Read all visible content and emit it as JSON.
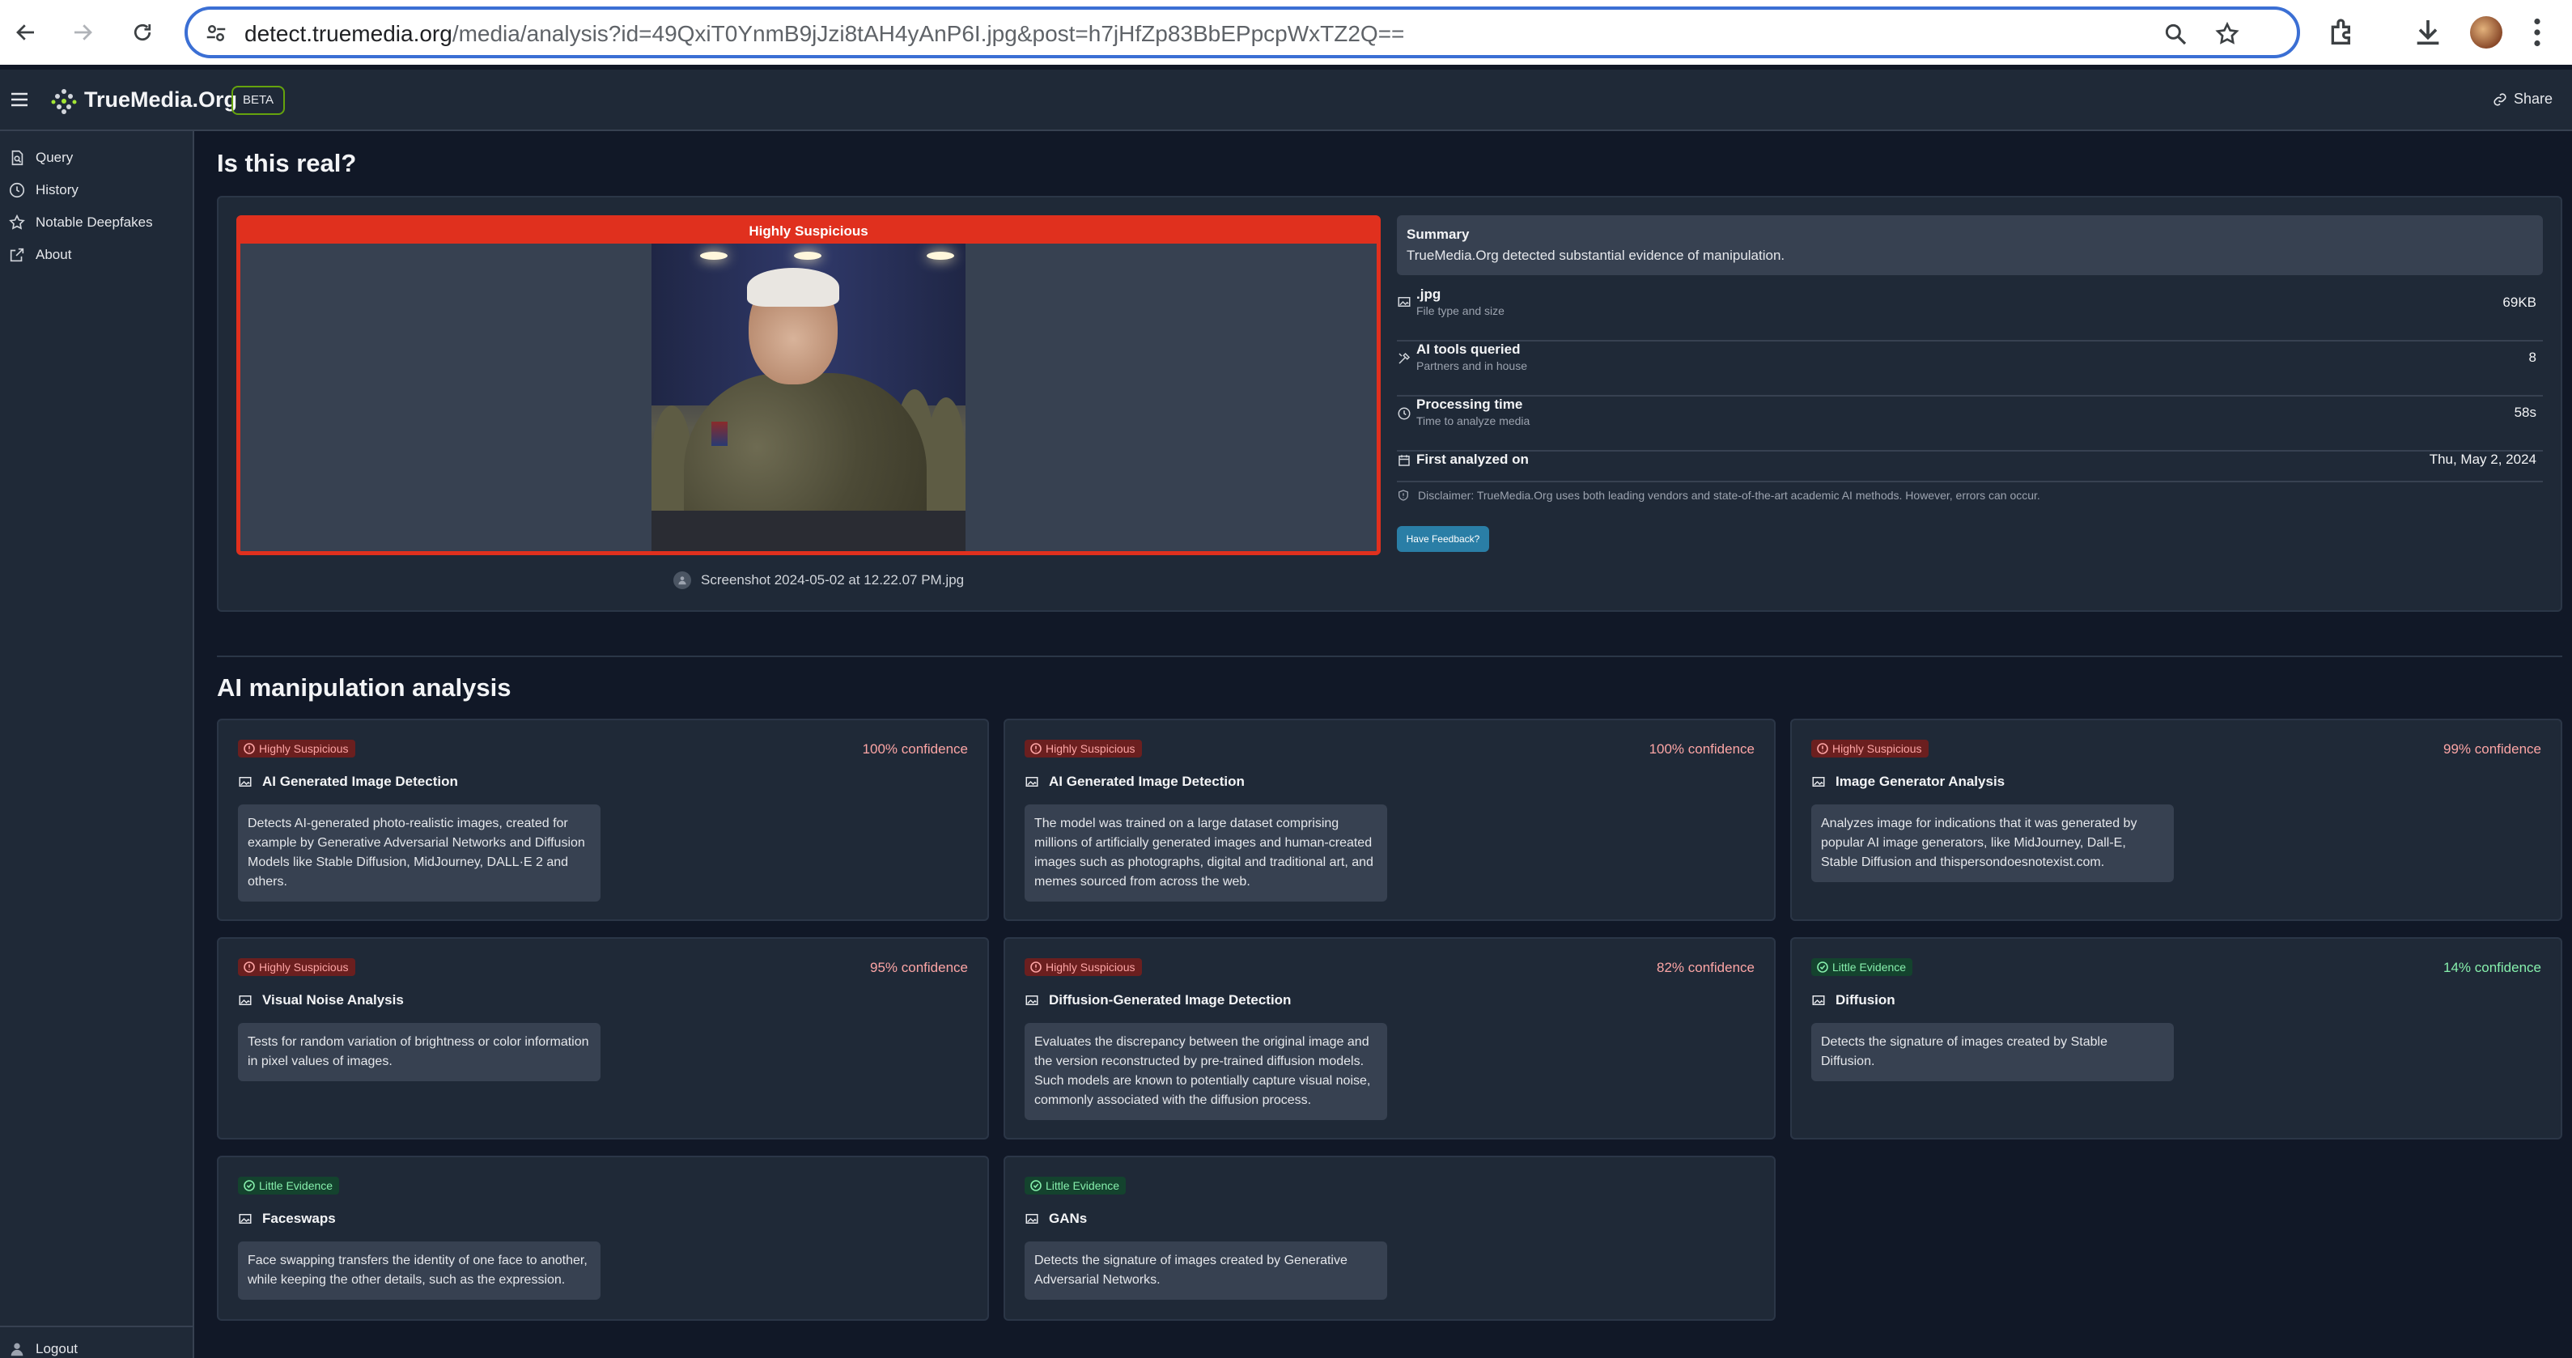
{
  "browser": {
    "url_host": "detect.truemedia.org",
    "url_path": "/media/analysis?id=49QxiT0YnmB9jJzi8tAH4yAnP6I.jpg&post=h7jHfZp83BbEPpcpWxTZ2Q=="
  },
  "app": {
    "brand": "TrueMedia.Org",
    "beta": "BETA",
    "share": "Share"
  },
  "sidebar": {
    "items": [
      {
        "label": "Query",
        "icon": "query-icon"
      },
      {
        "label": "History",
        "icon": "history-icon"
      },
      {
        "label": "Notable Deepfakes",
        "icon": "star-icon"
      },
      {
        "label": "About",
        "icon": "external-link-icon"
      }
    ],
    "logout": "Logout"
  },
  "page": {
    "title": "Is this real?",
    "verdict": "Highly Suspicious",
    "filename": "Screenshot 2024-05-02 at 12.22.07 PM.jpg",
    "summary_title": "Summary",
    "summary_text": "TrueMedia.Org detected substantial evidence of manipulation.",
    "info": [
      {
        "label": ".jpg",
        "sub": "File type and size",
        "value": "69KB"
      },
      {
        "label": "AI tools queried",
        "sub": "Partners and in house",
        "value": "8"
      },
      {
        "label": "Processing time",
        "sub": "Time to analyze media",
        "value": "58s"
      },
      {
        "label": "First analyzed on",
        "sub": "",
        "value": "Thu, May 2, 2024"
      }
    ],
    "disclaimer": "Disclaimer: TrueMedia.Org uses both leading vendors and state-of-the-art academic AI methods. However, errors can occur.",
    "feedback": "Have Feedback?",
    "analysis_title": "AI manipulation analysis"
  },
  "colors": {
    "suspicious": "#e0301e",
    "little_evidence": "#86efac",
    "feedback_button": "#2a7ea6",
    "beta_border": "#65a30d"
  },
  "cards": [
    {
      "status": "Highly Suspicious",
      "confidence": "100% confidence",
      "title": "AI Generated Image Detection",
      "desc": "Detects AI-generated photo-realistic images, created for example by Generative Adversarial Networks and Diffusion Models like Stable Diffusion, MidJourney, DALL·E 2 and others."
    },
    {
      "status": "Highly Suspicious",
      "confidence": "100% confidence",
      "title": "AI Generated Image Detection",
      "desc": "The model was trained on a large dataset comprising millions of artificially generated images and human-created images such as photographs, digital and traditional art, and memes sourced from across the web."
    },
    {
      "status": "Highly Suspicious",
      "confidence": "99% confidence",
      "title": "Image Generator Analysis",
      "desc": "Analyzes image for indications that it was generated by popular AI image generators, like MidJourney, Dall-E, Stable Diffusion and thispersondoesnotexist.com."
    },
    {
      "status": "Highly Suspicious",
      "confidence": "95% confidence",
      "title": "Visual Noise Analysis",
      "desc": "Tests for random variation of brightness or color information in pixel values of images."
    },
    {
      "status": "Highly Suspicious",
      "confidence": "82% confidence",
      "title": "Diffusion-Generated Image Detection",
      "desc": "Evaluates the discrepancy between the original image and the version reconstructed by pre-trained diffusion models. Such models are known to potentially capture visual noise, commonly associated with the diffusion process."
    },
    {
      "status": "Little Evidence",
      "confidence": "14% confidence",
      "title": "Diffusion",
      "desc": "Detects the signature of images created by Stable Diffusion."
    },
    {
      "status": "Little Evidence",
      "confidence": "",
      "title": "Faceswaps",
      "desc": "Face swapping transfers the identity of one face to another, while keeping the other details, such as the expression."
    },
    {
      "status": "Little Evidence",
      "confidence": "",
      "title": "GANs",
      "desc": "Detects the signature of images created by Generative Adversarial Networks."
    }
  ]
}
